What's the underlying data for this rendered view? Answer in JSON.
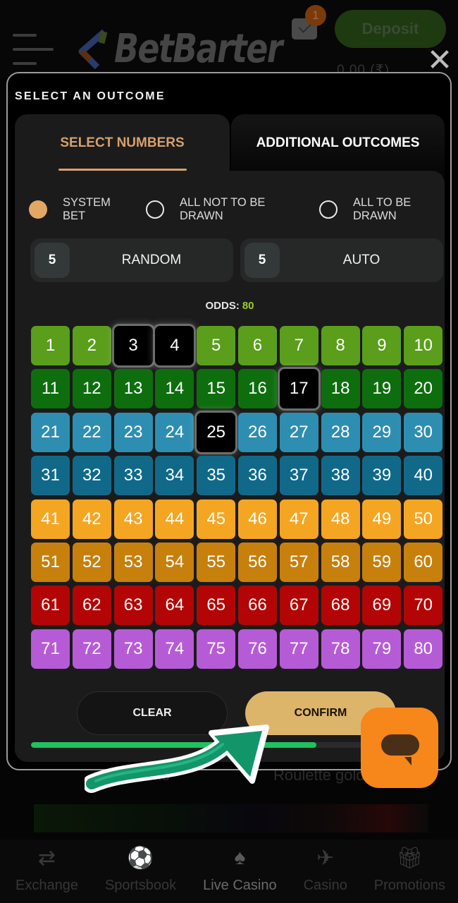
{
  "header": {
    "brand": "BetBarter",
    "mail_badge": "1",
    "deposit_label": "Deposit",
    "balance": "0.00 (₹)"
  },
  "modal": {
    "title": "SELECT AN OUTCOME",
    "close_icon": "close-icon",
    "tabs": [
      {
        "label": "SELECT NUMBERS",
        "active": true
      },
      {
        "label": "ADDITIONAL OUTCOMES",
        "active": false
      }
    ],
    "bet_types": [
      {
        "label": "SYSTEM BET",
        "checked": true
      },
      {
        "label": "ALL NOT TO BE DRAWN",
        "checked": false
      },
      {
        "label": "ALL TO BE DRAWN",
        "checked": false
      }
    ],
    "pick_buttons": [
      {
        "count": "5",
        "label": "RANDOM"
      },
      {
        "count": "5",
        "label": "AUTO"
      }
    ],
    "odds_label": "ODDS:",
    "odds_value": "80",
    "numbers": {
      "min": 1,
      "max": 80,
      "columns": 10,
      "row_colors": [
        "#5a9e1c",
        "#0e6e0e",
        "#2e8eb2",
        "#11698a",
        "#f4a623",
        "#c7800c",
        "#b30505",
        "#b65bd6"
      ],
      "selected": [
        3,
        4,
        17,
        25
      ]
    },
    "clear_label": "CLEAR",
    "confirm_label": "CONFIRM",
    "progress": 0.75
  },
  "background": {
    "labels": [
      "Keno",
      "Roulette gold"
    ]
  },
  "bottom_nav": [
    {
      "label": "Exchange",
      "icon": "exchange-icon",
      "active": false
    },
    {
      "label": "Sportsbook",
      "icon": "sportsbook-icon",
      "active": false
    },
    {
      "label": "Live Casino",
      "icon": "cards-icon",
      "active": true
    },
    {
      "label": "Casino",
      "icon": "plane-icon",
      "active": false
    },
    {
      "label": "Promotions",
      "icon": "gift-icon",
      "active": false
    }
  ],
  "colors": {
    "accent": "#d7a06c",
    "confirm": "#ddb56a",
    "odds": "#9ccc2a",
    "progress": "#1ec25e",
    "chat": "#f7861b"
  }
}
